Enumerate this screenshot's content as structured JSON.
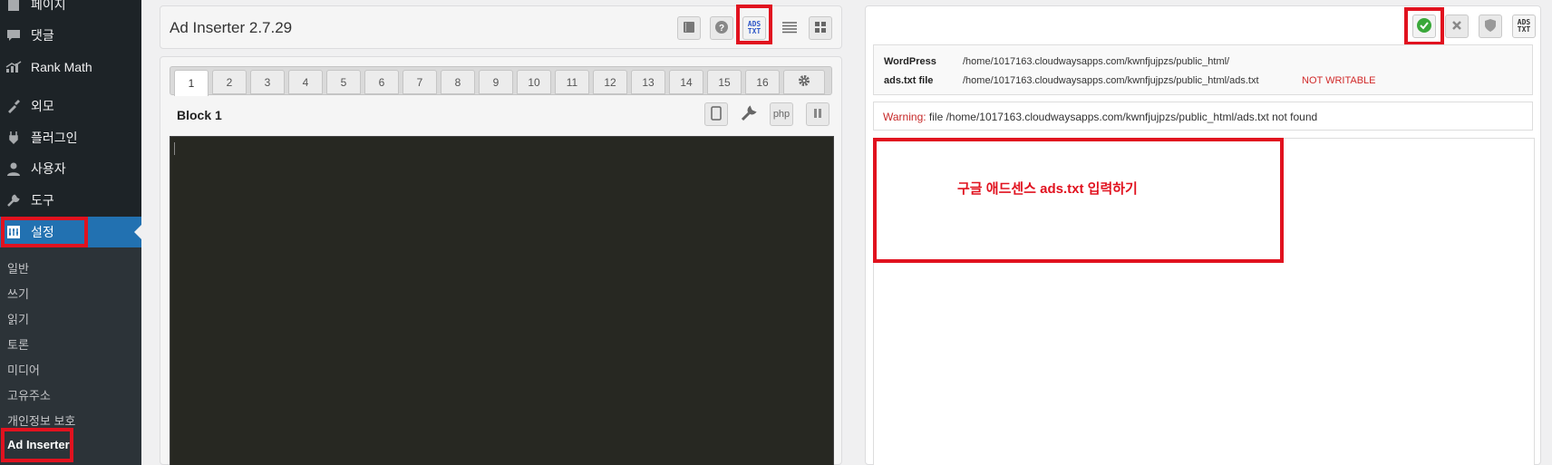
{
  "sidebar": {
    "items": [
      {
        "label": "페이지",
        "icon": "pages-icon"
      },
      {
        "label": "댓글",
        "icon": "comment-icon"
      },
      {
        "label": "Rank Math",
        "icon": "rank-math-icon"
      },
      {
        "label": "외모",
        "icon": "appearance-icon"
      },
      {
        "label": "플러그인",
        "icon": "plugin-icon"
      },
      {
        "label": "사용자",
        "icon": "user-icon"
      },
      {
        "label": "도구",
        "icon": "wrench-icon"
      },
      {
        "label": "설정",
        "icon": "settings-icon"
      }
    ],
    "submenu": [
      "일반",
      "쓰기",
      "읽기",
      "토론",
      "미디어",
      "고유주소",
      "개인정보 보호",
      "Ad Inserter"
    ]
  },
  "header": {
    "title": "Ad Inserter 2.7.29",
    "ads_txt_icon_line1": "ADS",
    "ads_txt_icon_line2": "TXT"
  },
  "tabs": [
    "1",
    "2",
    "3",
    "4",
    "5",
    "6",
    "7",
    "8",
    "9",
    "10",
    "11",
    "12",
    "13",
    "14",
    "15",
    "16"
  ],
  "block": {
    "title": "Block 1",
    "php_label": "php"
  },
  "right_panel": {
    "wordpress_label": "WordPress",
    "wordpress_path": "/home/1017163.cloudwaysapps.com/kwnfjujpzs/public_html/",
    "ads_file_label": "ads.txt file",
    "ads_file_path": "/home/1017163.cloudwaysapps.com/kwnfjujpzs/public_html/ads.txt",
    "not_writable": "NOT WRITABLE",
    "warning_label": "Warning:",
    "warning_text": "file /home/1017163.cloudwaysapps.com/kwnfjujpzs/public_html/ads.txt not found",
    "annotation": "구글 애드센스 ads.txt 입력하기"
  },
  "colors": {
    "accent": "#2271b1",
    "highlight_red": "#e1121f",
    "sidebar_bg": "#1d2327",
    "editor_bg": "#272822",
    "check_green": "#3aa83a"
  }
}
